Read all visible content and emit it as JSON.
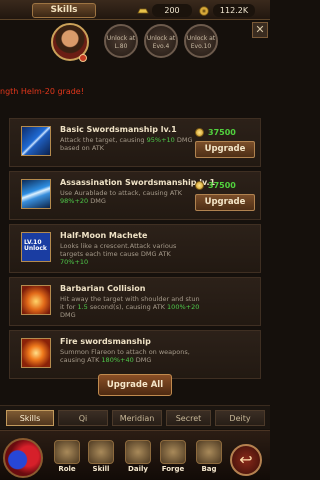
{
  "header": {
    "title": "Skills",
    "ingot": "200",
    "coins": "112.2K",
    "close_glyph": "✕"
  },
  "hero": {
    "unlocks": [
      "Unlock at L.80",
      "Unlock at Evo.4",
      "Unlock at Evo.10"
    ]
  },
  "set_banner": "ngth Helm-20 grade!",
  "skills": [
    {
      "name": "Basic Swordsmanship  lv.1",
      "desc_pre": "Attack the target, causing ",
      "desc_hl": "95%+10",
      "desc_post": " DMG based on ATK",
      "cost": "37500",
      "button": "Upgrade"
    },
    {
      "name": "Assassination Swordsmanship  lv.1",
      "desc_pre": "Use Aurablade to attack, causing ATK ",
      "desc_hl": "98%+20",
      "desc_post": " DMG",
      "cost": "37500",
      "button": "Upgrade"
    },
    {
      "name": "Half-Moon Machete",
      "desc_pre": "Looks like a crescent.Attack various targets each time cause DMG ATK ",
      "desc_hl": "70%+10",
      "desc_post": "",
      "icon_text": "LV.10 Unlock"
    },
    {
      "name": "Barbarian Collision",
      "desc_pre": "Hit away the target with shoulder and stun it for ",
      "desc_hl": "1.5",
      "desc_post": " second(s), causing ATK ",
      "desc_hl2": "100%+20",
      "desc_post2": " DMG"
    },
    {
      "name": "Fire swordsmanship",
      "desc_pre": "Summon Flareon to attach on weapons, causing ATK ",
      "desc_hl": "180%+40",
      "desc_post": " DMG"
    }
  ],
  "upgrade_all": "Upgrade All",
  "tabs": [
    "Skills",
    "Qi",
    "Meridian",
    "Secret",
    "Deity"
  ],
  "nav": [
    "Role",
    "Skill",
    "Daily",
    "Forge",
    "Bag"
  ],
  "back_glyph": "↩",
  "colors": {
    "highlight": "#4ec94a",
    "cost": "#51d13d",
    "banner": "#e0361b"
  }
}
